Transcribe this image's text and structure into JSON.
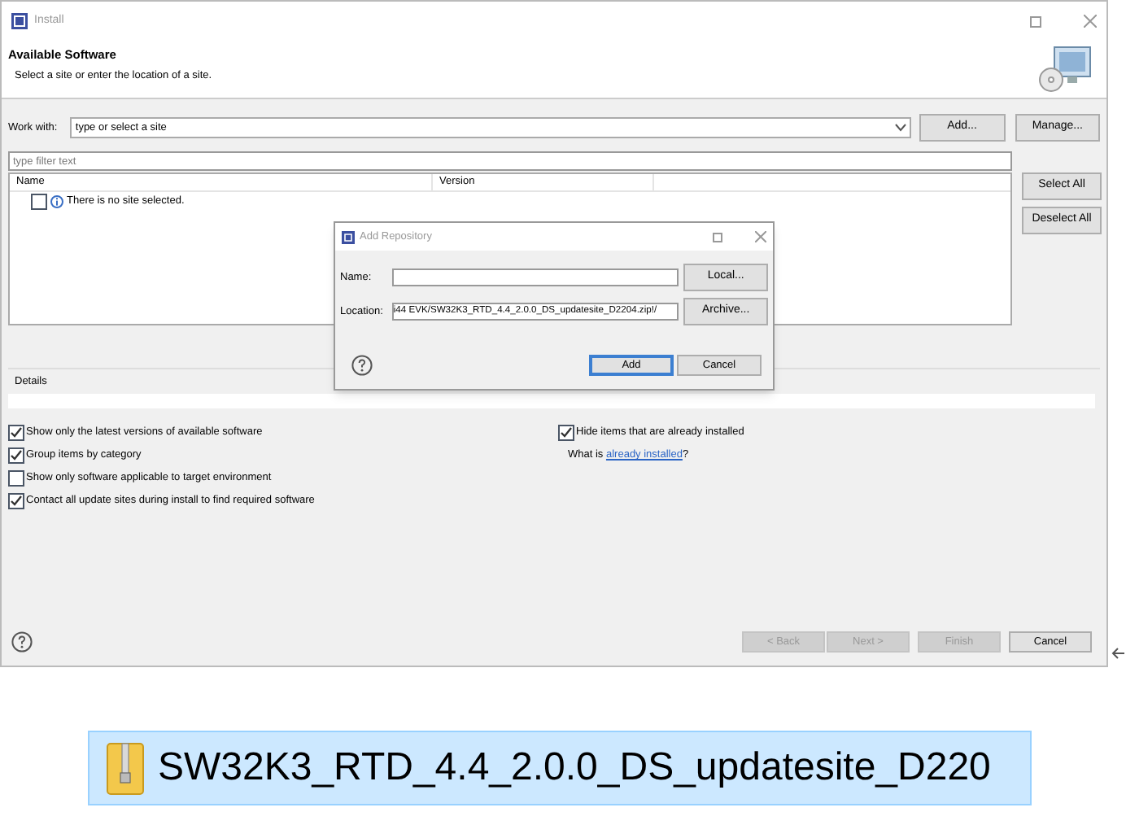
{
  "window": {
    "title": "Install"
  },
  "header": {
    "title": "Available Software",
    "subtitle": "Select a site or enter the location of a site."
  },
  "work_with": {
    "label": "Work with:",
    "placeholder": "type or select a site",
    "add_button": "Add...",
    "manage_button": "Manage..."
  },
  "filter": {
    "placeholder": "type filter text",
    "select_all": "Select All",
    "deselect_all": "Deselect All"
  },
  "table": {
    "columns": [
      "Name",
      "Version"
    ],
    "rows": [
      {
        "text": "There is no site selected.",
        "checked": false
      }
    ]
  },
  "details": {
    "label": "Details"
  },
  "options_left": [
    {
      "label": "Show only the latest versions of available software",
      "checked": true
    },
    {
      "label": "Group items by category",
      "checked": true
    },
    {
      "label": "Show only software applicable to target environment",
      "checked": false
    },
    {
      "label": "Contact all update sites during install to find required software",
      "checked": true
    }
  ],
  "options_right": [
    {
      "label": "Hide items that are already installed",
      "checked": true
    }
  ],
  "installed_link": {
    "prefix": "What is ",
    "link": "already installed",
    "suffix": "?"
  },
  "footer_buttons": [
    {
      "label": "< Back",
      "disabled": true
    },
    {
      "label": "Next >",
      "disabled": true
    },
    {
      "label": "Finish",
      "disabled": true
    },
    {
      "label": "Cancel",
      "disabled": false
    }
  ],
  "dialog": {
    "title": "Add Repository",
    "name_label": "Name:",
    "location_label": "Location:",
    "location_value": "i44 EVK/SW32K3_RTD_4.4_2.0.0_DS_updatesite_D2204.zip!/",
    "local_button": "Local...",
    "archive_button": "Archive...",
    "buttons": [
      {
        "label": "Add",
        "default": true
      },
      {
        "label": "Cancel",
        "default": false
      }
    ]
  },
  "file": {
    "name": "SW32K3_RTD_4.4_2.0.0_DS_updatesite_D220",
    "selected": true
  }
}
